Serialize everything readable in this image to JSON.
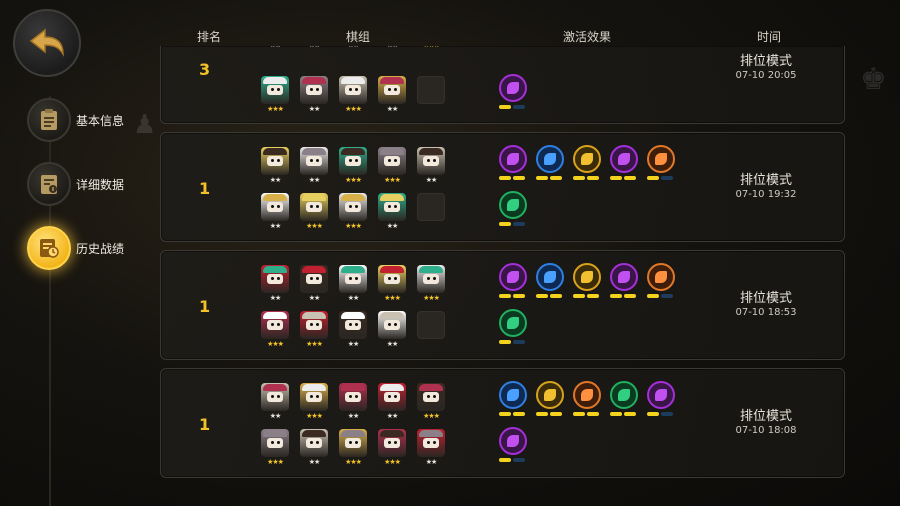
{
  "nav": {
    "back_icon": "back-arrow-icon",
    "items": [
      {
        "label": "基本信息",
        "icon": "clipboard-icon",
        "active": false
      },
      {
        "label": "详细数据",
        "icon": "data-sheet-icon",
        "active": false
      },
      {
        "label": "历史战绩",
        "icon": "history-clock-icon",
        "active": true
      }
    ]
  },
  "headers": {
    "rank": "排名",
    "lineup": "棋组",
    "traits": "激活效果",
    "time": "时间"
  },
  "colors": {
    "accent": "#f3c229",
    "bar_on": "#f3d31e",
    "bar_off": "#1d3b5c"
  },
  "matches": [
    {
      "rank": "3",
      "mode": "排位模式",
      "time": "07-10 20:05",
      "row1": [
        {
          "stars": "★★"
        },
        {
          "stars": "★★"
        },
        {
          "stars": "★★"
        },
        {
          "stars": "★★"
        },
        {
          "stars": "★★★"
        }
      ],
      "row2": [
        {
          "stars": "★★★"
        },
        {
          "stars": "★★"
        },
        {
          "stars": "★★★"
        },
        {
          "stars": "★★"
        },
        {
          "stars": ""
        }
      ],
      "traits1": [
        "purple",
        "gold",
        "blue",
        "orange",
        "green"
      ],
      "traits2": [
        "purple"
      ]
    },
    {
      "rank": "1",
      "mode": "排位模式",
      "time": "07-10 19:32",
      "row1": [
        {
          "stars": "★★"
        },
        {
          "stars": "★★"
        },
        {
          "stars": "★★★"
        },
        {
          "stars": "★★★"
        },
        {
          "stars": "★★"
        }
      ],
      "row2": [
        {
          "stars": "★★"
        },
        {
          "stars": "★★★"
        },
        {
          "stars": "★★★"
        },
        {
          "stars": "★★"
        },
        {
          "stars": ""
        }
      ],
      "traits1": [
        "purple",
        "blue",
        "gold",
        "purple",
        "orange"
      ],
      "traits2": [
        "green"
      ]
    },
    {
      "rank": "1",
      "mode": "排位模式",
      "time": "07-10 18:53",
      "row1": [
        {
          "stars": "★★"
        },
        {
          "stars": "★★"
        },
        {
          "stars": "★★"
        },
        {
          "stars": "★★★"
        },
        {
          "stars": "★★★"
        }
      ],
      "row2": [
        {
          "stars": "★★★"
        },
        {
          "stars": "★★★"
        },
        {
          "stars": "★★"
        },
        {
          "stars": "★★"
        },
        {
          "stars": ""
        }
      ],
      "traits1": [
        "purple",
        "blue",
        "gold",
        "purple",
        "orange"
      ],
      "traits2": [
        "green"
      ]
    },
    {
      "rank": "1",
      "mode": "排位模式",
      "time": "07-10 18:08",
      "row1": [
        {
          "stars": "★★"
        },
        {
          "stars": "★★★"
        },
        {
          "stars": "★★"
        },
        {
          "stars": "★★"
        },
        {
          "stars": "★★★"
        }
      ],
      "row2": [
        {
          "stars": "★★★"
        },
        {
          "stars": "★★"
        },
        {
          "stars": "★★★"
        },
        {
          "stars": "★★★"
        },
        {
          "stars": "★★"
        }
      ],
      "traits1": [
        "blue",
        "gold",
        "orange",
        "green",
        "purple"
      ],
      "traits2": [
        "purple"
      ]
    }
  ]
}
